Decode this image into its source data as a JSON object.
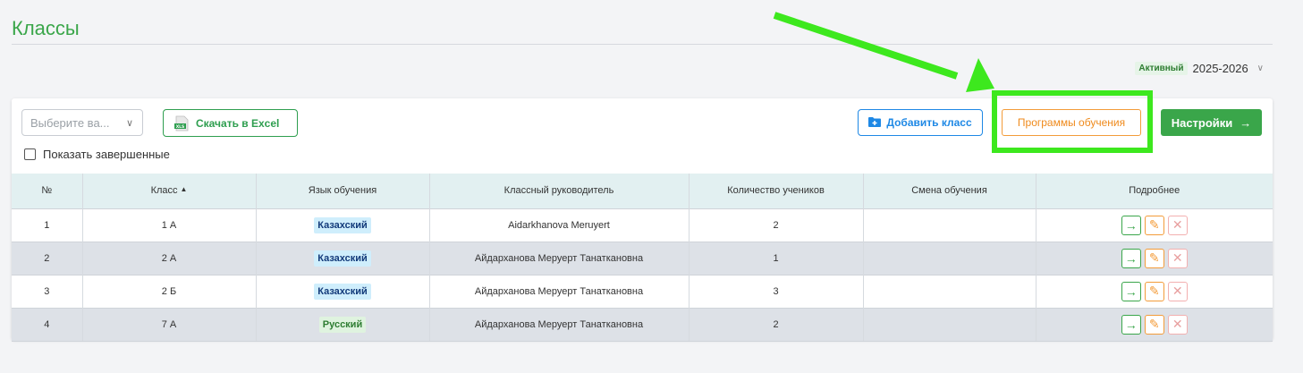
{
  "page": {
    "title": "Классы"
  },
  "year_selector": {
    "status_badge": "Активный",
    "value": "2025-2026"
  },
  "toolbar": {
    "select_placeholder": "Выберите ва...",
    "excel_label": "Скачать в Excel",
    "show_finished_label": "Показать завершенные",
    "add_class_label": "Добавить класс",
    "programs_label": "Программы обучения",
    "settings_label": "Настройки"
  },
  "table": {
    "headers": [
      "№",
      "Класс",
      "Язык обучения",
      "Классный руководитель",
      "Количество учеников",
      "Смена обучения",
      "Подробнее"
    ],
    "rows": [
      {
        "num": "1",
        "class": "1 А",
        "lang": "Казахский",
        "teacher": "Aidarkhanova Meruyert",
        "count": "2",
        "shift": ""
      },
      {
        "num": "2",
        "class": "2 А",
        "lang": "Казахский",
        "teacher": "Айдарханова Меруерт Танаткановна",
        "count": "1",
        "shift": ""
      },
      {
        "num": "3",
        "class": "2 Б",
        "lang": "Казахский",
        "teacher": "Айдарханова Меруерт Танаткановна",
        "count": "3",
        "shift": ""
      },
      {
        "num": "4",
        "class": "7 А",
        "lang": "Русский",
        "teacher": "Айдарханова Меруерт Танаткановна",
        "count": "2",
        "shift": ""
      }
    ]
  },
  "colors": {
    "accent_green": "#3aa64a",
    "annotation_green": "#3de81e",
    "orange": "#f39c3a",
    "blue": "#1e88e5"
  }
}
